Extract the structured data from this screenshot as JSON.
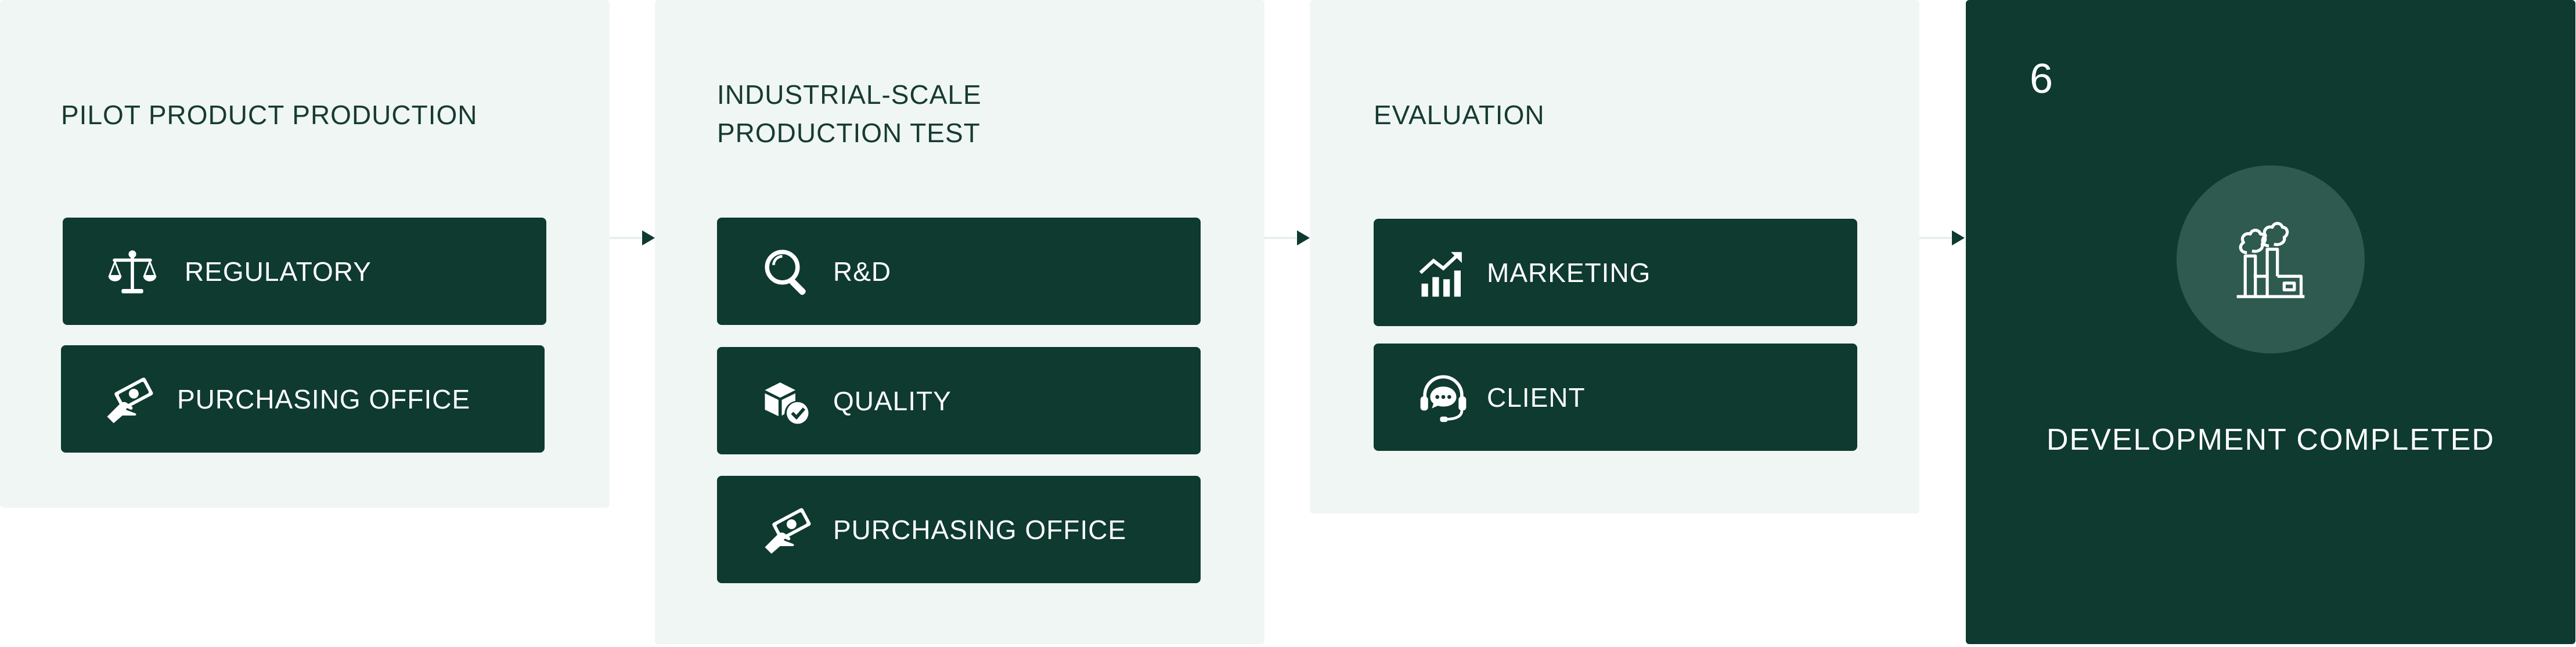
{
  "colors": {
    "panel_bg": "#f0f6f4",
    "pill_bg": "#0e3a2f",
    "accent": "#0e3a2f",
    "circle": "#2e5a4f",
    "connector": "#e2ece8"
  },
  "stages": [
    {
      "title": "PILOT PRODUCT PRODUCTION",
      "items": [
        {
          "label": "REGULATORY",
          "icon": "scale-icon"
        },
        {
          "label": "PURCHASING OFFICE",
          "icon": "money-hand-icon"
        }
      ]
    },
    {
      "title": "INDUSTRIAL-SCALE PRODUCTION TEST",
      "items": [
        {
          "label": "R&D",
          "icon": "magnifier-icon"
        },
        {
          "label": "QUALITY",
          "icon": "box-check-icon"
        },
        {
          "label": "PURCHASING OFFICE",
          "icon": "money-hand-icon"
        }
      ]
    },
    {
      "title": "EVALUATION",
      "items": [
        {
          "label": "MARKETING",
          "icon": "chart-up-icon"
        },
        {
          "label": "CLIENT",
          "icon": "headset-icon"
        }
      ]
    }
  ],
  "final": {
    "number": "6",
    "label": "DEVELOPMENT COMPLETED",
    "icon": "factory-icon"
  }
}
